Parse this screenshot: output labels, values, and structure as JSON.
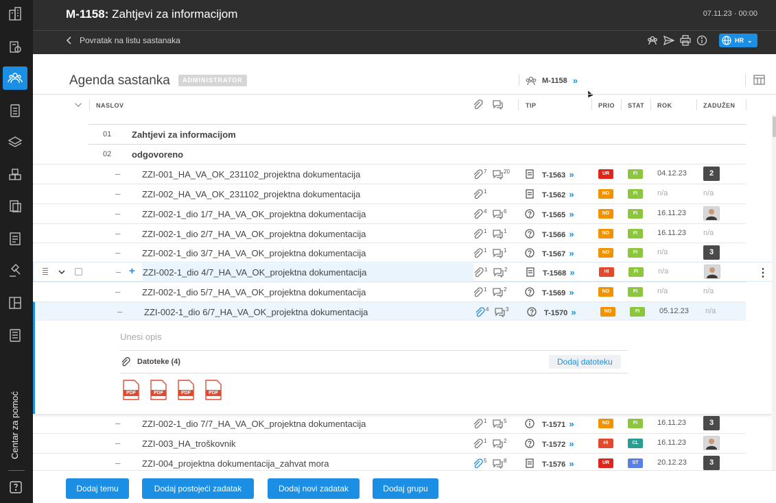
{
  "sidebar": {
    "help_label": "Centar za pomoć"
  },
  "header": {
    "meeting_code": "M-1158:",
    "meeting_title": "Zahtjevi za informacijom",
    "datetime": "07.11.23 · 00:00",
    "back_label": "Povratak na listu sastanaka",
    "language": "HR"
  },
  "agenda": {
    "title": "Agenda sastanka",
    "role_badge": "ADMINISTRATOR",
    "meeting_ref": "M-1158",
    "chevron": "»"
  },
  "columns": {
    "naslov": "NASLOV",
    "tip": "TIP",
    "prio": "PRIO",
    "stat": "STAT",
    "rok": "ROK",
    "zaduzen": "ZADUŽEN"
  },
  "groups": [
    {
      "num": "01",
      "title": "Zahtjevi za informacijom"
    },
    {
      "num": "02",
      "title": "odgovoreno"
    }
  ],
  "tasks": [
    {
      "dash": "–",
      "title": "ZZI-001_HA_VA_OK_231102_projektna dokumentacija",
      "att": "7",
      "com": "20",
      "type_icon": "doc-icon",
      "tnum": "T-1563",
      "prio": "UR",
      "prio_color": "#e0261b",
      "stat": "FI",
      "stat_color": "#8cc63f",
      "rok": "04.12.23",
      "assignee": "2",
      "assignee_kind": "num"
    },
    {
      "dash": "–",
      "title": "ZZI-002_HA_VA_OK_231102_projektna dokumentacija",
      "att": "1",
      "com": "",
      "type_icon": "doc-icon",
      "tnum": "T-1562",
      "prio": "NO",
      "prio_color": "#f39200",
      "stat": "FI",
      "stat_color": "#8cc63f",
      "rok": "n/a",
      "assignee": "n/a",
      "assignee_kind": "na"
    },
    {
      "dash": "–",
      "title": "ZZI-002-1_dio 1/7_HA_VA_OK_projektna dokumentacija",
      "att": "4",
      "com": "6",
      "type_icon": "question-icon",
      "tnum": "T-1565",
      "prio": "NO",
      "prio_color": "#f39200",
      "stat": "FI",
      "stat_color": "#8cc63f",
      "rok": "16.11.23",
      "assignee": "",
      "assignee_kind": "avatar"
    },
    {
      "dash": "–",
      "title": "ZZI-002-1_dio 2/7_HA_VA_OK_projektna dokumentacija",
      "att": "1",
      "com": "1",
      "type_icon": "question-icon",
      "tnum": "T-1566",
      "prio": "NO",
      "prio_color": "#f39200",
      "stat": "FI",
      "stat_color": "#8cc63f",
      "rok": "16.11.23",
      "assignee": "n/a",
      "assignee_kind": "na"
    },
    {
      "dash": "–",
      "title": "ZZI-002-1_dio 3/7_HA_VA_OK_projektna dokumentacija",
      "att": "1",
      "com": "1",
      "type_icon": "question-icon",
      "tnum": "T-1567",
      "prio": "NO",
      "prio_color": "#f39200",
      "stat": "FI",
      "stat_color": "#8cc63f",
      "rok": "n/a",
      "assignee": "3",
      "assignee_kind": "num"
    },
    {
      "dash": "–",
      "title": "ZZI-002-1_dio 4/7_HA_VA_OK_projektna dokumentacija",
      "att": "1",
      "com": "2",
      "type_icon": "doc-icon",
      "tnum": "T-1568",
      "prio": "HI",
      "prio_color": "#e2492f",
      "stat": "FI",
      "stat_color": "#8cc63f",
      "rok": "n/a",
      "assignee": "",
      "assignee_kind": "avatar",
      "plus": "+"
    },
    {
      "dash": "–",
      "title": "ZZI-002-1_dio 5/7_HA_VA_OK_projektna dokumentacija",
      "att": "1",
      "com": "2",
      "type_icon": "question-icon",
      "tnum": "T-1569",
      "prio": "NO",
      "prio_color": "#f39200",
      "stat": "FI",
      "stat_color": "#8cc63f",
      "rok": "n/a",
      "assignee": "n/a",
      "assignee_kind": "na"
    },
    {
      "dash": "–",
      "title": "ZZI-002-1_dio 6/7_HA_VA_OK_projektna dokumentacija",
      "att": "4",
      "com": "3",
      "type_icon": "question-icon",
      "tnum": "T-1570",
      "prio": "NO",
      "prio_color": "#f39200",
      "stat": "FI",
      "stat_color": "#8cc63f",
      "rok": "05.12.23",
      "assignee": "n/a",
      "assignee_kind": "na"
    },
    {
      "dash": "–",
      "title": "ZZI-002-1_dio 7/7_HA_VA_OK_projektna dokumentacija",
      "att": "1",
      "com": "5",
      "type_icon": "info-icon",
      "tnum": "T-1571",
      "prio": "NO",
      "prio_color": "#f39200",
      "stat": "FI",
      "stat_color": "#8cc63f",
      "rok": "16.11.23",
      "assignee": "3",
      "assignee_kind": "num"
    },
    {
      "dash": "–",
      "title": "ZZI-003_HA_troškovnik",
      "att": "1",
      "com": "2",
      "type_icon": "question-icon",
      "tnum": "T-1572",
      "prio": "HI",
      "prio_color": "#e2492f",
      "stat": "CL",
      "stat_color": "#2a9d8f",
      "rok": "16.11.23",
      "assignee": "",
      "assignee_kind": "avatar"
    },
    {
      "dash": "–",
      "title": "ZZI-004_projektna dokumentacija_zahvat mora",
      "att": "5",
      "com": "8",
      "type_icon": "doc-icon",
      "tnum": "T-1576",
      "prio": "UR",
      "prio_color": "#e0261b",
      "stat": "ST",
      "stat_color": "#5b7fe8",
      "rok": "20.12.23",
      "assignee": "3",
      "assignee_kind": "num"
    }
  ],
  "expanded": {
    "description_placeholder": "Unesi opis",
    "files_label": "Datoteke (4)",
    "add_file": "Dodaj datoteku",
    "file_type": "PDF"
  },
  "bottom": {
    "add_topic": "Dodaj temu",
    "add_existing": "Dodaj postojeći zadatak",
    "add_new": "Dodaj novi zadatak",
    "add_group": "Dodaj grupu"
  }
}
